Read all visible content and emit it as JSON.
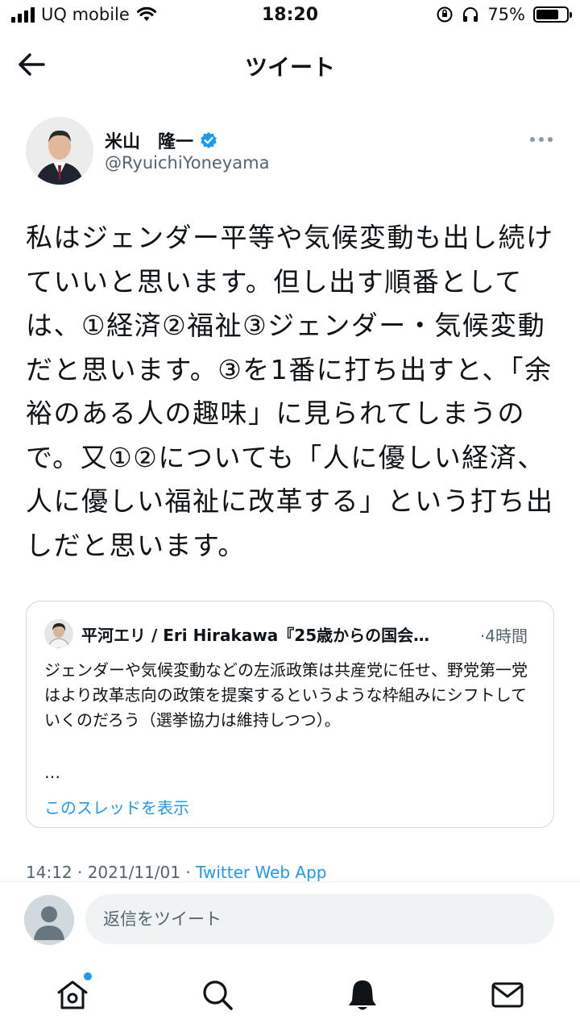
{
  "status_bar": {
    "carrier": "UQ mobile",
    "time": "18:20",
    "battery_percent": "75%",
    "battery_level": 0.75
  },
  "header": {
    "title": "ツイート"
  },
  "author": {
    "name": "米山　隆一",
    "handle": "@RyuichiYoneyama",
    "verified": true
  },
  "tweet": {
    "text": "私はジェンダー平等や気候変動も出し続けていいと思います。但し出す順番としては、①経済②福祉③ジェンダー・気候変動だと思います。③を1番に打ち出すと、「余裕のある人の趣味」に見られてしまうので。又①②についても「人に優しい経済、人に優しい福祉に改革する」という打ち出しだと思います。"
  },
  "quote": {
    "name": "平河エリ / Eri Hirakawa『25歳からの国会…",
    "time": "·4時間",
    "text": "ジェンダーや気候変動などの左派政策は共産党に任せ、野党第一党はより改革志向の政策を提案するというような枠組みにシフトしていくのだろう（選挙協力は維持しつつ）。",
    "ellipsis": "…",
    "show_thread": "このスレッドを表示"
  },
  "meta": {
    "timestamp": "14:12 · 2021/11/01 · ",
    "source": "Twitter Web App"
  },
  "reply": {
    "placeholder": "返信をツイート"
  },
  "nav": {
    "items": [
      "home-icon",
      "search-icon",
      "notifications-icon",
      "messages-icon"
    ],
    "home_has_new": true
  },
  "colors": {
    "accent": "#1d9bf0",
    "text": "#0f1419",
    "muted": "#536471",
    "border": "#cfd9de"
  }
}
